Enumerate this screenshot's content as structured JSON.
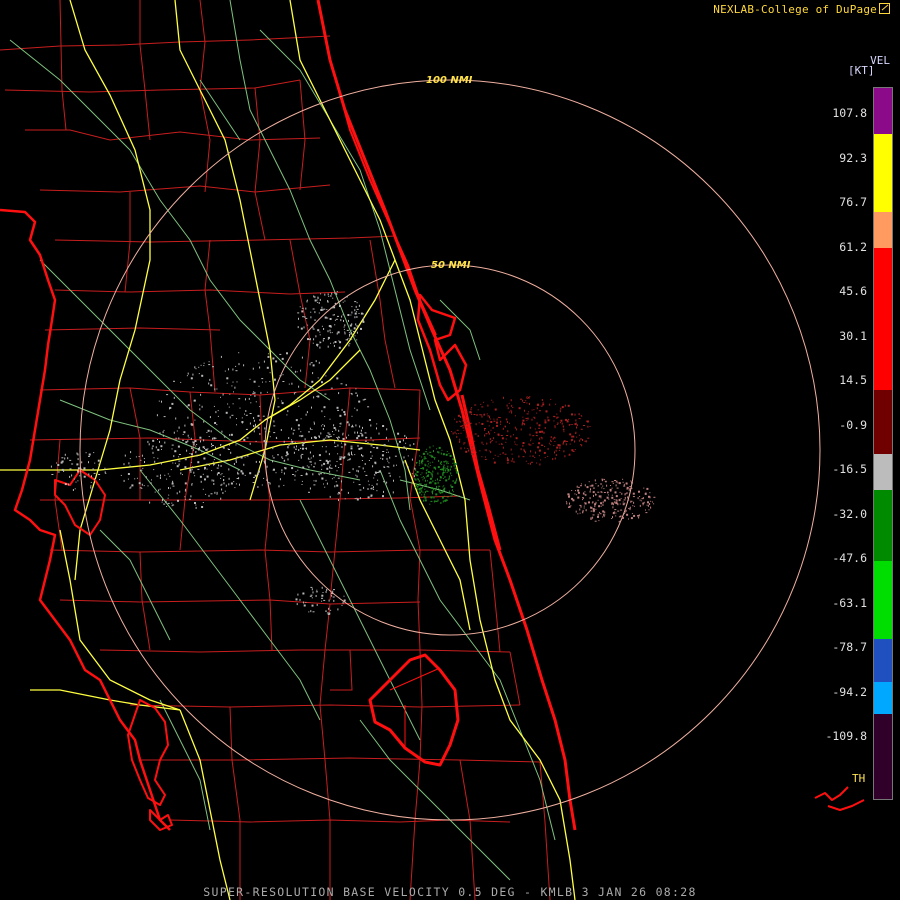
{
  "credit": "NEXLAB-College of DuPage",
  "caption": "SUPER-RESOLUTION BASE VELOCITY 0.5 DEG - KMLB 3 JAN 26 08:28",
  "legend": {
    "title": "VEL",
    "units": "[KT]",
    "ticks": [
      "107.8",
      "92.3",
      "76.7",
      "61.2",
      "45.6",
      "30.1",
      "14.5",
      "-0.9",
      "-16.5",
      "-32.0",
      "-47.6",
      "-63.1",
      "-78.7",
      "-94.2",
      "-109.8"
    ],
    "th_label": "TH",
    "segments": [
      {
        "color": "#8a0a8a",
        "frac": 0.065
      },
      {
        "color": "#ffff00",
        "frac": 0.11
      },
      {
        "color": "#ff9a60",
        "frac": 0.05
      },
      {
        "color": "#ff0000",
        "frac": 0.2
      },
      {
        "color": "#700000",
        "frac": 0.09
      },
      {
        "color": "#bcbcbc",
        "frac": 0.05
      },
      {
        "color": "#008a00",
        "frac": 0.1
      },
      {
        "color": "#00dd00",
        "frac": 0.11
      },
      {
        "color": "#2050c0",
        "frac": 0.06
      },
      {
        "color": "#00a8ff",
        "frac": 0.045
      },
      {
        "color": "#30002a",
        "frac": 0.12
      }
    ]
  },
  "range_rings": [
    {
      "label": "100 NMI",
      "nmi": 100
    },
    {
      "label": "50 NMI",
      "nmi": 50
    }
  ],
  "colors": {
    "counties": "#c81e1e",
    "highways": "#ffff40",
    "rivers": "#7ec27e",
    "coast": "#ff1010",
    "rings": "#f0b0a0",
    "echo_outbound": "#a82020",
    "echo_near_zero": "#b8b8b8",
    "echo_inbound": "#1f8a1f"
  }
}
